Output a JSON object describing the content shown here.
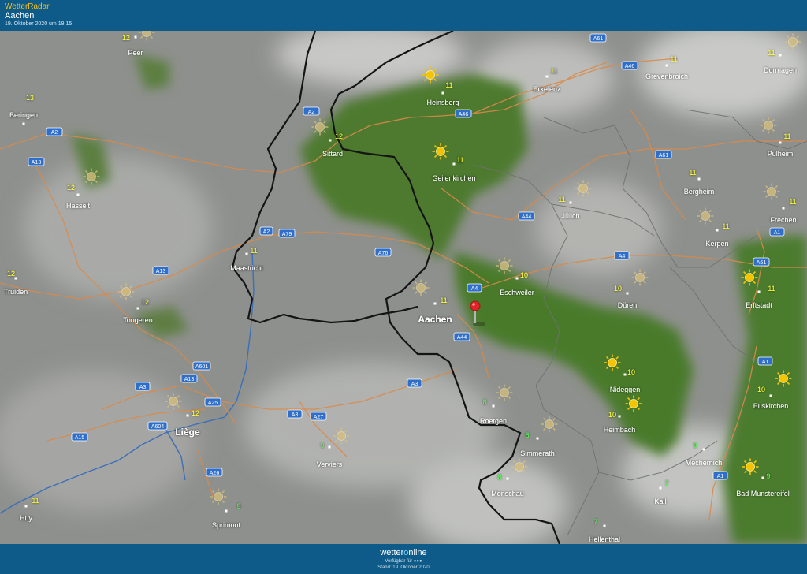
{
  "header": {
    "app_title": "WetterRadar",
    "location": "Aachen",
    "datetime": "19. Oktober 2020 um 18:15"
  },
  "footer": {
    "brand_prefix": "wetter",
    "brand_o": "o",
    "brand_suffix": "nline",
    "availability": "Verfügbar für ●●●",
    "stand": "Stand: 19. Oktober 2020"
  },
  "colors": {
    "header_bg": "#0e5a88",
    "title_accent": "#f6c21a",
    "temp_yellow": "#ffff33",
    "temp_green": "#4cff4c",
    "road_orange": "#d98a4a",
    "road_sign": "#2f6fc9",
    "river": "#3c6fb8",
    "border": "#141414",
    "sun": "#f5c400",
    "pin": "#e0242a"
  },
  "cities": [
    {
      "name": "Peer",
      "temp": "12",
      "temp_color": "yellow",
      "sun": "pale"
    },
    {
      "name": "Beringen",
      "temp": "13",
      "temp_color": "yellow",
      "sun": "none"
    },
    {
      "name": "Heinsberg",
      "temp": "11",
      "temp_color": "yellow",
      "sun": "bright"
    },
    {
      "name": "Erkelenz",
      "temp": "11",
      "temp_color": "yellow",
      "sun": "none"
    },
    {
      "name": "Grevenbroich",
      "temp": "11",
      "temp_color": "yellow",
      "sun": "none"
    },
    {
      "name": "Dormagen",
      "temp": "11",
      "temp_color": "yellow",
      "sun": "pale"
    },
    {
      "name": "Sittard",
      "temp": "12",
      "temp_color": "yellow",
      "sun": "pale"
    },
    {
      "name": "Geilenkirchen",
      "temp": "11",
      "temp_color": "yellow",
      "sun": "bright"
    },
    {
      "name": "Pulheim",
      "temp": "11",
      "temp_color": "yellow",
      "sun": "pale"
    },
    {
      "name": "Hasselt",
      "temp": "12",
      "temp_color": "yellow",
      "sun": "pale"
    },
    {
      "name": "Bergheim",
      "temp": "11",
      "temp_color": "yellow",
      "sun": "none"
    },
    {
      "name": "Jülich",
      "temp": "11",
      "temp_color": "yellow",
      "sun": "pale"
    },
    {
      "name": "Frechen",
      "temp": "11",
      "temp_color": "yellow",
      "sun": "pale"
    },
    {
      "name": "Kerpen",
      "temp": "11",
      "temp_color": "yellow",
      "sun": "pale"
    },
    {
      "name": "Maastricht",
      "temp": "11",
      "temp_color": "yellow",
      "sun": "none"
    },
    {
      "name": "Truiden",
      "temp": "12",
      "temp_color": "yellow",
      "sun": "none"
    },
    {
      "name": "Eschweiler",
      "temp": "10",
      "temp_color": "yellow",
      "sun": "pale"
    },
    {
      "name": "Düren",
      "temp": "10",
      "temp_color": "yellow",
      "sun": "pale"
    },
    {
      "name": "Erftstadt",
      "temp": "11",
      "temp_color": "yellow",
      "sun": "bright"
    },
    {
      "name": "Tongeren",
      "temp": "12",
      "temp_color": "yellow",
      "sun": "pale"
    },
    {
      "name": "Aachen",
      "temp": "11",
      "temp_color": "yellow",
      "sun": "pale"
    },
    {
      "name": "Nideggen",
      "temp": "10",
      "temp_color": "yellow",
      "sun": "bright"
    },
    {
      "name": "Euskirchen",
      "temp": "10",
      "temp_color": "yellow",
      "sun": "bright"
    },
    {
      "name": "Roetgen",
      "temp": "8",
      "temp_color": "green",
      "sun": "pale"
    },
    {
      "name": "Heimbach",
      "temp": "10",
      "temp_color": "yellow",
      "sun": "bright"
    },
    {
      "name": "Liège",
      "temp": "12",
      "temp_color": "yellow",
      "sun": "pale"
    },
    {
      "name": "Simmerath",
      "temp": "8",
      "temp_color": "green",
      "sun": "pale"
    },
    {
      "name": "Verviers",
      "temp": "9",
      "temp_color": "green",
      "sun": "pale"
    },
    {
      "name": "Mechernich",
      "temp": "9",
      "temp_color": "green",
      "sun": "none"
    },
    {
      "name": "Bad Munstereifel",
      "temp": "9",
      "temp_color": "green",
      "sun": "bright"
    },
    {
      "name": "Monschau",
      "temp": "8",
      "temp_color": "green",
      "sun": "pale"
    },
    {
      "name": "Kall",
      "temp": "7",
      "temp_color": "green",
      "sun": "none"
    },
    {
      "name": "Huy",
      "temp": "11",
      "temp_color": "yellow",
      "sun": "none"
    },
    {
      "name": "Sprimont",
      "temp": "9",
      "temp_color": "green",
      "sun": "pale"
    },
    {
      "name": "Hellenthal",
      "temp": "7",
      "temp_color": "green",
      "sun": "none"
    }
  ],
  "roads": [
    "A61",
    "A46",
    "A2",
    "A46",
    "A2",
    "A13",
    "A61",
    "A44",
    "A2",
    "A79",
    "A76",
    "A1",
    "A13",
    "A4",
    "A61",
    "A4",
    "A44",
    "A1",
    "A601",
    "A13",
    "A3",
    "A25",
    "A3",
    "A3",
    "A27",
    "A604",
    "A15",
    "A26",
    "A1"
  ]
}
